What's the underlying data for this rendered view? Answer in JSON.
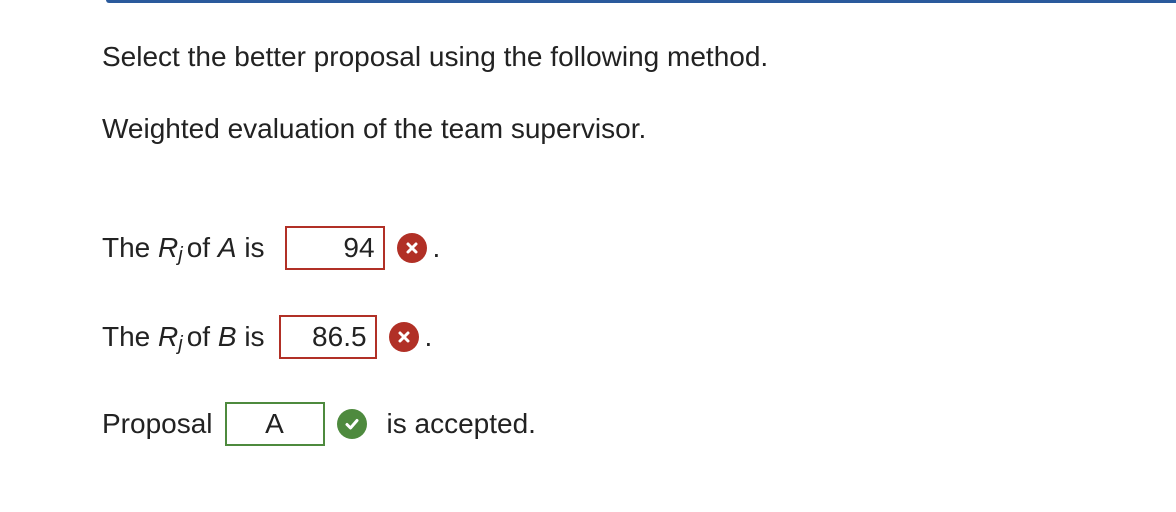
{
  "question": {
    "instruction": "Select the better proposal using the following method.",
    "method": "Weighted evaluation of the team supervisor."
  },
  "rows": {
    "a": {
      "prefix": "The ",
      "var": "R",
      "sub": "j",
      "middle": "of ",
      "name": "A",
      "suffix": " is",
      "answer": "94",
      "status": "incorrect",
      "end": "."
    },
    "b": {
      "prefix": "The ",
      "var": "R",
      "sub": "j",
      "middle": "of ",
      "name": "B",
      "suffix": " is",
      "answer": "86.5",
      "status": "incorrect",
      "end": "."
    },
    "c": {
      "prefix": "Proposal",
      "answer": "A",
      "status": "correct",
      "end": "is accepted."
    }
  },
  "colors": {
    "incorrect": "#b13026",
    "correct": "#4e8a3e",
    "accent_rule": "#2a5a9c"
  },
  "icons": {
    "incorrect": "x-circle-icon",
    "correct": "check-circle-icon"
  }
}
